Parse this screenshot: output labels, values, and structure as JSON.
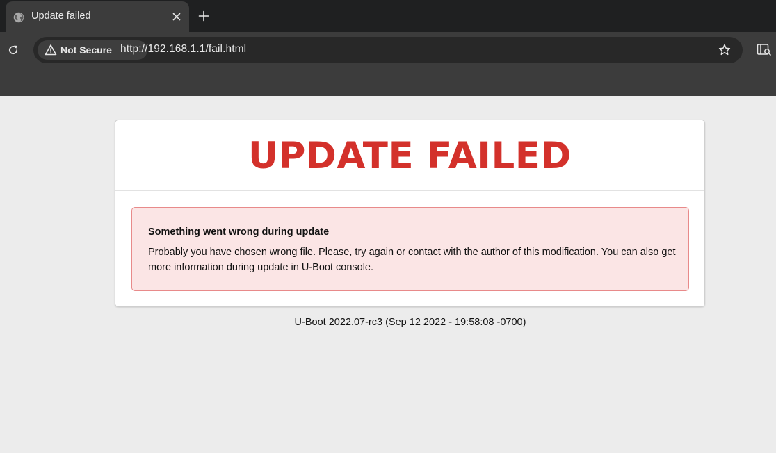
{
  "browser": {
    "tab": {
      "title": "Update failed",
      "favicon": "globe-icon"
    },
    "omnibox": {
      "security_label": "Not Secure",
      "url": "http://192.168.1.1/fail.html"
    }
  },
  "page": {
    "headline": "UPDATE FAILED",
    "alert": {
      "title": "Something went wrong during update",
      "body": "Probably you have chosen wrong file. Please, try again or contact with the author of this modification. You can also get more information during update in U-Boot console."
    },
    "footer": "U-Boot 2022.07-rc3 (Sep 12 2022 - 19:58:08 -0700)"
  },
  "colors": {
    "headline": "#d3312b",
    "alert_background": "#fbe5e5",
    "alert_border": "#e88a8a",
    "page_background": "#ececec"
  }
}
